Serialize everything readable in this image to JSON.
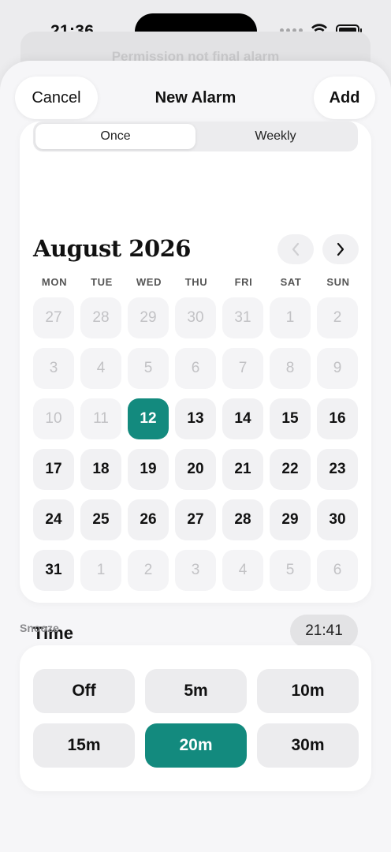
{
  "status_bar": {
    "time": "21:36"
  },
  "background_sheet": {
    "title": "Permission not final alarm"
  },
  "nav": {
    "cancel_label": "Cancel",
    "title": "New Alarm",
    "add_label": "Add"
  },
  "repeat": {
    "options": [
      {
        "label": "Once",
        "selected": true
      },
      {
        "label": "Weekly",
        "selected": false
      }
    ]
  },
  "calendar": {
    "month_title": "August 2026",
    "prev_icon": "chevron-left-icon",
    "next_icon": "chevron-right-icon",
    "weekdays": [
      "MON",
      "TUE",
      "WED",
      "THU",
      "FRI",
      "SAT",
      "SUN"
    ],
    "days": [
      {
        "n": "27",
        "state": "muted"
      },
      {
        "n": "28",
        "state": "muted"
      },
      {
        "n": "29",
        "state": "muted"
      },
      {
        "n": "30",
        "state": "muted"
      },
      {
        "n": "31",
        "state": "muted"
      },
      {
        "n": "1",
        "state": "muted"
      },
      {
        "n": "2",
        "state": "muted"
      },
      {
        "n": "3",
        "state": "muted"
      },
      {
        "n": "4",
        "state": "muted"
      },
      {
        "n": "5",
        "state": "muted"
      },
      {
        "n": "6",
        "state": "muted"
      },
      {
        "n": "7",
        "state": "muted"
      },
      {
        "n": "8",
        "state": "muted"
      },
      {
        "n": "9",
        "state": "muted"
      },
      {
        "n": "10",
        "state": "muted"
      },
      {
        "n": "11",
        "state": "muted"
      },
      {
        "n": "12",
        "state": "selected"
      },
      {
        "n": "13",
        "state": "normal"
      },
      {
        "n": "14",
        "state": "normal"
      },
      {
        "n": "15",
        "state": "normal"
      },
      {
        "n": "16",
        "state": "normal"
      },
      {
        "n": "17",
        "state": "normal"
      },
      {
        "n": "18",
        "state": "normal"
      },
      {
        "n": "19",
        "state": "normal"
      },
      {
        "n": "20",
        "state": "normal"
      },
      {
        "n": "21",
        "state": "normal"
      },
      {
        "n": "22",
        "state": "normal"
      },
      {
        "n": "23",
        "state": "normal"
      },
      {
        "n": "24",
        "state": "normal"
      },
      {
        "n": "25",
        "state": "normal"
      },
      {
        "n": "26",
        "state": "normal"
      },
      {
        "n": "27",
        "state": "normal"
      },
      {
        "n": "28",
        "state": "normal"
      },
      {
        "n": "29",
        "state": "normal"
      },
      {
        "n": "30",
        "state": "normal"
      },
      {
        "n": "31",
        "state": "normal"
      },
      {
        "n": "1",
        "state": "muted"
      },
      {
        "n": "2",
        "state": "muted"
      },
      {
        "n": "3",
        "state": "muted"
      },
      {
        "n": "4",
        "state": "muted"
      },
      {
        "n": "5",
        "state": "muted"
      },
      {
        "n": "6",
        "state": "muted"
      }
    ]
  },
  "time": {
    "label": "Time",
    "value": "21:41"
  },
  "snooze": {
    "label": "Snooze",
    "options": [
      {
        "label": "Off",
        "selected": false
      },
      {
        "label": "5m",
        "selected": false
      },
      {
        "label": "10m",
        "selected": false
      },
      {
        "label": "15m",
        "selected": false
      },
      {
        "label": "20m",
        "selected": true
      },
      {
        "label": "30m",
        "selected": false
      }
    ]
  },
  "colors": {
    "accent": "#138a7e"
  }
}
